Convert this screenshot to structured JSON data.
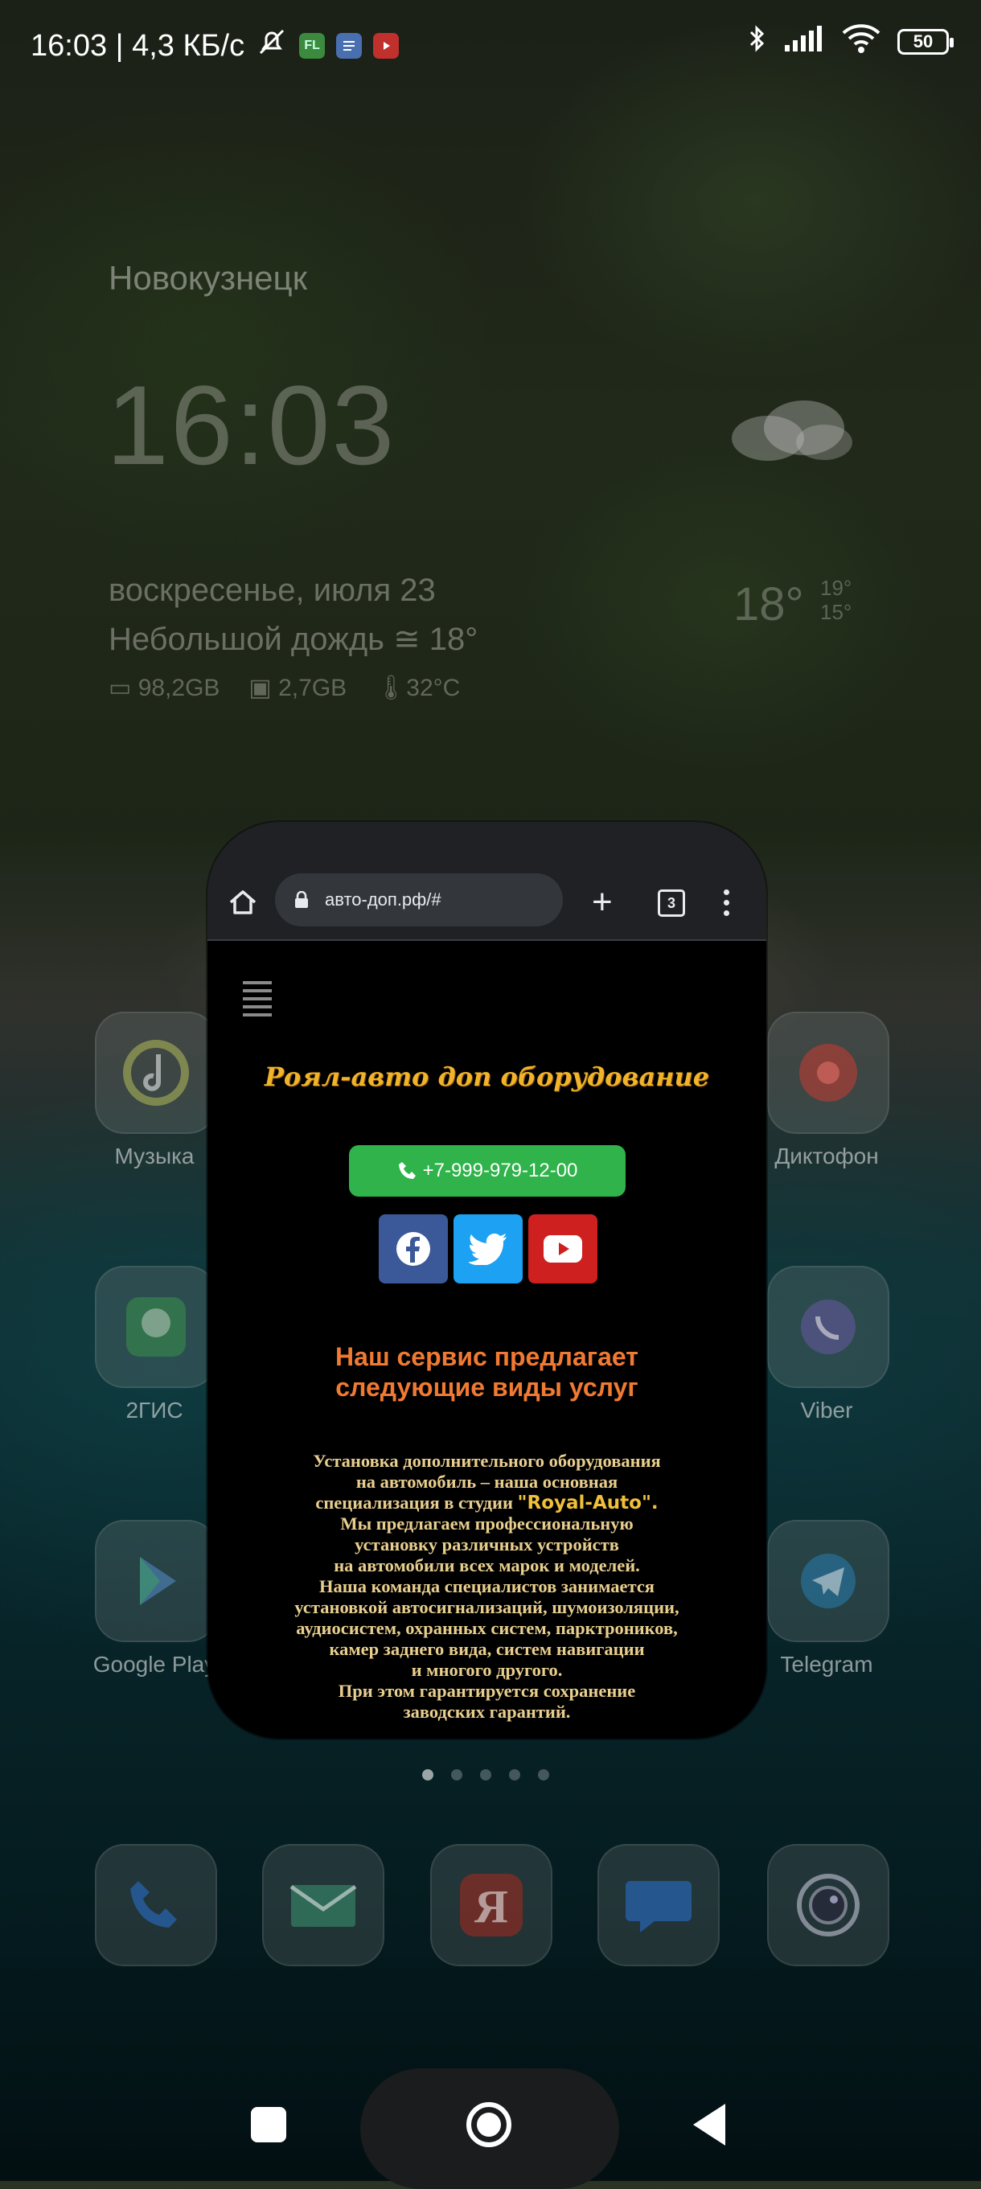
{
  "status_bar": {
    "time_speed": "16:03 | 4,3 КБ/с",
    "app_icons": [
      "mute-icon",
      "fl-app-icon",
      "notes-app-icon",
      "youtube-app-icon"
    ],
    "fl_label": "FL",
    "battery": "50",
    "right_icons": [
      "bluetooth-icon",
      "signal-icon",
      "wifi-icon",
      "battery-icon"
    ]
  },
  "widget": {
    "city": "Новокузнецк",
    "time": "16:03",
    "date": "воскресенье, июля 23",
    "weather": "Небольшой дождь ≅ 18°",
    "storage": "98,2GB",
    "ram": "2,7GB",
    "temperature": "32°C",
    "current_temp": "18°",
    "high": "19°",
    "low": "15°"
  },
  "home_apps": [
    {
      "label": "Музыка"
    },
    {
      "label": "Диктофон"
    },
    {
      "label": "2ГИС"
    },
    {
      "label": "Viber"
    },
    {
      "label": "Google Play"
    },
    {
      "label": "Telegram"
    }
  ],
  "page_indicator": {
    "count": 5,
    "active": 1
  },
  "browser": {
    "url": "авто-доп.рф/#",
    "tab_count": "3"
  },
  "site": {
    "title": "Роял-авто доп оборудование",
    "phone": "+7-999-979-12-00",
    "social": [
      "facebook-icon",
      "twitter-icon",
      "youtube-icon"
    ],
    "services_heading_1": "Наш сервис предлагает",
    "services_heading_2": "следующие виды услуг",
    "desc_1": "Установка дополнительного оборудования",
    "desc_2": "на автомобиль – наша основная",
    "desc_3": "специализация в студии",
    "desc_brand": "\"Royal-Auto\".",
    "desc_4": "Мы предлагаем профессиональную",
    "desc_5": "установку различных устройств",
    "desc_6": "на автомобили всех марок и моделей.",
    "desc_7": "Наша команда специалистов занимается",
    "desc_8": "установкой автосигнализаций, шумоизоляции,",
    "desc_9": "аудиосистем, охранных систем, парктроников,",
    "desc_10": "камер заднего вида, систем навигации",
    "desc_11": "и многого другого.",
    "desc_12": "При этом гарантируется сохранение",
    "desc_13": "заводских гарантий."
  },
  "dock": [
    "phone-icon",
    "mail-icon",
    "yandex-icon",
    "messages-icon",
    "camera-icon"
  ],
  "colors": {
    "phone_button": "#2fb34a",
    "facebook": "#3b5998",
    "twitter": "#1da1f2",
    "youtube": "#cd201f",
    "heading": "#f07a32",
    "title": "#f0b32a",
    "text": "#e9cf8e"
  }
}
